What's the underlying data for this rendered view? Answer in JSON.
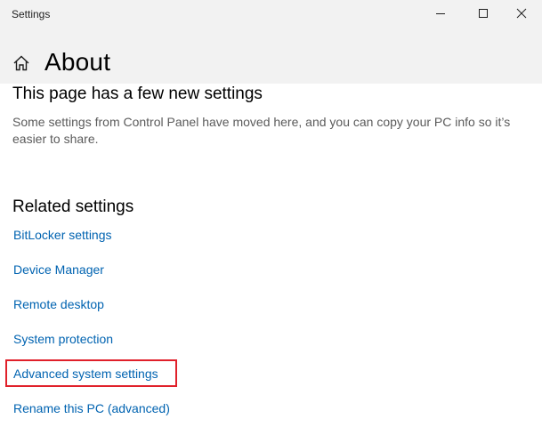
{
  "window": {
    "title": "Settings",
    "controls": {
      "minimize_icon": "minimize-icon",
      "maximize_icon": "maximize-icon",
      "close_icon": "close-icon"
    }
  },
  "header": {
    "home_icon": "home-icon",
    "title": "About"
  },
  "new_settings": {
    "heading": "This page has a few new settings",
    "description": "Some settings from Control Panel have moved here, and you can copy your PC info so it’s easier to share."
  },
  "related_settings": {
    "heading": "Related settings",
    "links": [
      {
        "label": "BitLocker settings"
      },
      {
        "label": "Device Manager"
      },
      {
        "label": "Remote desktop"
      },
      {
        "label": "System protection"
      },
      {
        "label": "Advanced system settings"
      },
      {
        "label": "Rename this PC (advanced)"
      }
    ]
  },
  "colors": {
    "link": "#0063b1",
    "highlight": "#e0202a",
    "titlebar": "#f2f2f2"
  }
}
